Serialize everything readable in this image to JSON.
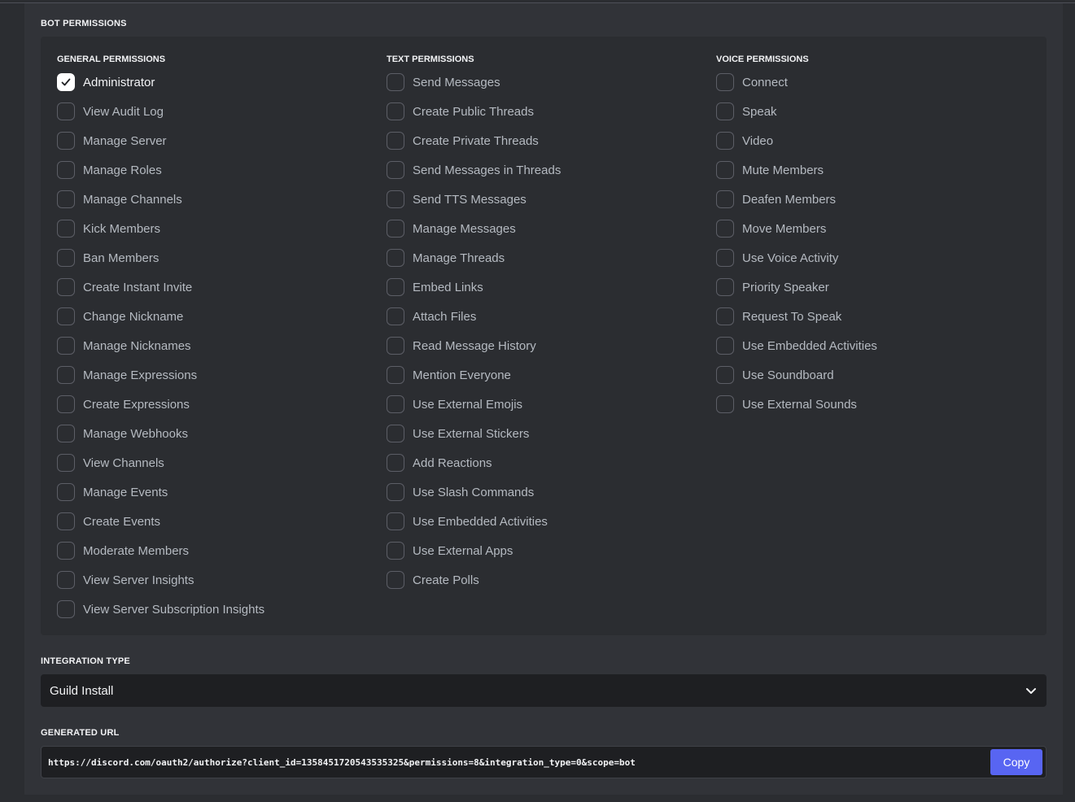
{
  "bot_permissions": {
    "title": "BOT PERMISSIONS",
    "columns": [
      {
        "title": "GENERAL PERMISSIONS",
        "items": [
          {
            "label": "Administrator",
            "checked": true
          },
          {
            "label": "View Audit Log",
            "checked": false
          },
          {
            "label": "Manage Server",
            "checked": false
          },
          {
            "label": "Manage Roles",
            "checked": false
          },
          {
            "label": "Manage Channels",
            "checked": false
          },
          {
            "label": "Kick Members",
            "checked": false
          },
          {
            "label": "Ban Members",
            "checked": false
          },
          {
            "label": "Create Instant Invite",
            "checked": false
          },
          {
            "label": "Change Nickname",
            "checked": false
          },
          {
            "label": "Manage Nicknames",
            "checked": false
          },
          {
            "label": "Manage Expressions",
            "checked": false
          },
          {
            "label": "Create Expressions",
            "checked": false
          },
          {
            "label": "Manage Webhooks",
            "checked": false
          },
          {
            "label": "View Channels",
            "checked": false
          },
          {
            "label": "Manage Events",
            "checked": false
          },
          {
            "label": "Create Events",
            "checked": false
          },
          {
            "label": "Moderate Members",
            "checked": false
          },
          {
            "label": "View Server Insights",
            "checked": false
          },
          {
            "label": "View Server Subscription Insights",
            "checked": false
          }
        ]
      },
      {
        "title": "TEXT PERMISSIONS",
        "items": [
          {
            "label": "Send Messages",
            "checked": false
          },
          {
            "label": "Create Public Threads",
            "checked": false
          },
          {
            "label": "Create Private Threads",
            "checked": false
          },
          {
            "label": "Send Messages in Threads",
            "checked": false
          },
          {
            "label": "Send TTS Messages",
            "checked": false
          },
          {
            "label": "Manage Messages",
            "checked": false
          },
          {
            "label": "Manage Threads",
            "checked": false
          },
          {
            "label": "Embed Links",
            "checked": false
          },
          {
            "label": "Attach Files",
            "checked": false
          },
          {
            "label": "Read Message History",
            "checked": false
          },
          {
            "label": "Mention Everyone",
            "checked": false
          },
          {
            "label": "Use External Emojis",
            "checked": false
          },
          {
            "label": "Use External Stickers",
            "checked": false
          },
          {
            "label": "Add Reactions",
            "checked": false
          },
          {
            "label": "Use Slash Commands",
            "checked": false
          },
          {
            "label": "Use Embedded Activities",
            "checked": false
          },
          {
            "label": "Use External Apps",
            "checked": false
          },
          {
            "label": "Create Polls",
            "checked": false
          }
        ]
      },
      {
        "title": "VOICE PERMISSIONS",
        "items": [
          {
            "label": "Connect",
            "checked": false
          },
          {
            "label": "Speak",
            "checked": false
          },
          {
            "label": "Video",
            "checked": false
          },
          {
            "label": "Mute Members",
            "checked": false
          },
          {
            "label": "Deafen Members",
            "checked": false
          },
          {
            "label": "Move Members",
            "checked": false
          },
          {
            "label": "Use Voice Activity",
            "checked": false
          },
          {
            "label": "Priority Speaker",
            "checked": false
          },
          {
            "label": "Request To Speak",
            "checked": false
          },
          {
            "label": "Use Embedded Activities",
            "checked": false
          },
          {
            "label": "Use Soundboard",
            "checked": false
          },
          {
            "label": "Use External Sounds",
            "checked": false
          }
        ]
      }
    ]
  },
  "integration_type": {
    "title": "INTEGRATION TYPE",
    "selected": "Guild Install"
  },
  "generated_url": {
    "title": "GENERATED URL",
    "url": "https://discord.com/oauth2/authorize?client_id=1358451720543535325&permissions=8&integration_type=0&scope=bot",
    "copy_label": "Copy"
  },
  "colors": {
    "accent": "#5865f2",
    "background": "#2b2d31",
    "panel": "#313338"
  }
}
